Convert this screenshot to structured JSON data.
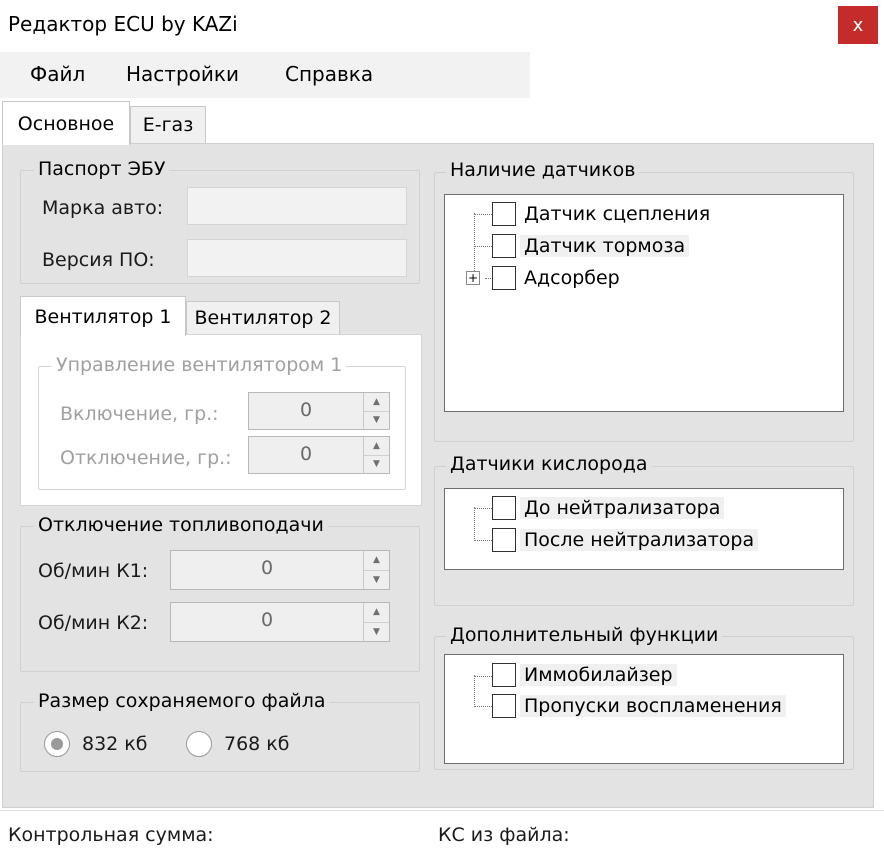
{
  "window": {
    "title": "Редактор ECU by  KAZi",
    "close_glyph": "x"
  },
  "menu": {
    "items": [
      "Файл",
      "Настройки",
      "Справка"
    ]
  },
  "tabs": [
    "Основное",
    "Е-газ"
  ],
  "passport": {
    "legend": "Паспорт ЭБУ",
    "car_label": "Марка авто:",
    "car_value": "",
    "version_label": "Версия ПО:",
    "version_value": ""
  },
  "fan": {
    "tabs": [
      "Вентилятор 1",
      "Вентилятор 2"
    ],
    "legend": "Управление вентилятором 1",
    "on_label": "Включение, гр.:",
    "on_value": "0",
    "off_label": "Отключение, гр.:",
    "off_value": "0"
  },
  "fuel_cut": {
    "legend": "Отключение топливоподачи",
    "k1_label": "Об/мин К1:",
    "k1_value": "0",
    "k2_label": "Об/мин К2:",
    "k2_value": "0"
  },
  "file_size": {
    "legend": "Размер сохраняемого файла",
    "options": [
      "832 кб",
      "768 кб"
    ],
    "selected": "832 кб"
  },
  "sensors": {
    "legend": "Наличие датчиков",
    "items": [
      "Датчик сцепления",
      "Датчик тормоза",
      "Адсорбер"
    ]
  },
  "oxygen": {
    "legend": "Датчики кислорода",
    "items": [
      "До нейтрализатора",
      "После нейтрализатора"
    ]
  },
  "extra": {
    "legend": "Дополнительный функции",
    "items": [
      "Иммобилайзер",
      "Пропуски воспламенения"
    ]
  },
  "status": {
    "checksum_label": "Контрольная сумма:",
    "file_checksum_label": "КС из файла:"
  },
  "colors": {
    "close_button": "#c42b2b",
    "panel_bg": "#e3e3e3",
    "menu_bg": "#f2f2f2"
  },
  "icons": {
    "close": "close-icon",
    "spin_up": "chevron-up-icon",
    "spin_down": "chevron-down-icon",
    "expand": "plus-expander-icon"
  }
}
